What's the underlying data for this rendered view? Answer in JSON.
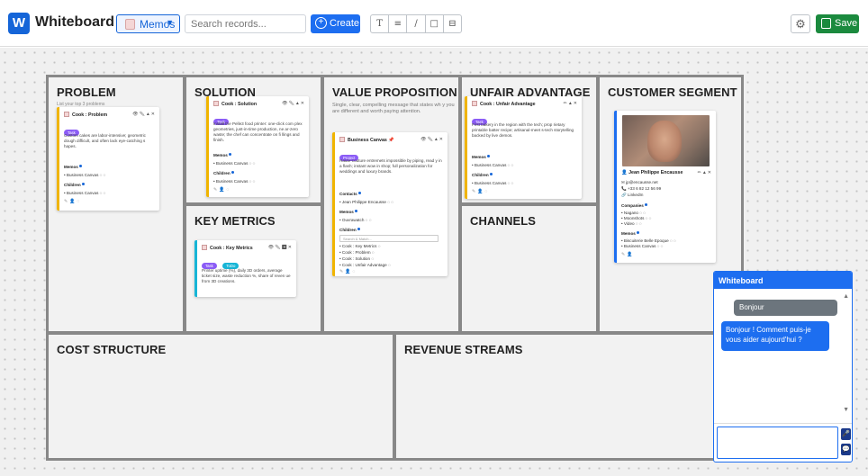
{
  "header": {
    "logo_letter": "W",
    "app_title": "Whiteboard",
    "memos_label": "Memos",
    "search_placeholder": "Search records...",
    "create_label": "Create",
    "tools": [
      "T",
      "≡",
      "/",
      "□",
      "⊟"
    ],
    "settings_icon": "gear-icon",
    "save_label": "Save"
  },
  "board": {
    "problem": {
      "title": "PROBLEM",
      "sub": "List your top 3 problems",
      "card": {
        "title": "Cook : Problem",
        "tags": [
          "Task"
        ],
        "desc": "Custom cakes are labor-intensive; geometric dough difficult, and often lack eye-catching s hapes.",
        "memos_label": "Memos",
        "memos": [
          "Business Canvas"
        ],
        "children_label": "Children",
        "children": [
          "Business Canvas"
        ]
      }
    },
    "solution": {
      "title": "SOLUTION",
      "card": {
        "title": "Cook : Solution",
        "tags": [
          "Task"
        ],
        "desc": "Install the Pelle3 food printer: one-click com plex geometries, just-in-time production, ne ar-zero waste; the chef can concentrate on fi llings and finish.",
        "memos_label": "Memos",
        "memos": [
          "Business Canvas"
        ],
        "children_label": "Children",
        "children": [
          "Business Canvas"
        ]
      }
    },
    "value": {
      "title": "VALUE PROPOSITION",
      "sub": "Single, clear, compelling message that states wh y you are different and worth paying attention.",
      "card": {
        "title": "Business Canvas",
        "tags": [
          "Project"
        ],
        "desc": "Haute-couture entremets impossible by piping, read y in a flash; instant wow in shop; full personalization for weddings and luxury brands.",
        "contacts_label": "Contacts",
        "contacts": [
          "Jean Philippe Encausse"
        ],
        "memos_label": "Memos",
        "memos": [
          "Ouvrawatch"
        ],
        "children_label": "Children",
        "children_search": "Search & Match...",
        "children": [
          "Cook : Key Metrics",
          "Cook : Problem",
          "Cook : Solution",
          "Cook : Unfair Advantage"
        ]
      }
    },
    "unfair": {
      "title": "UNFAIR ADVANTAGE",
      "card": {
        "title": "Cook : Unfair Advantage",
        "tags": [
          "Task"
        ],
        "desc": "First bakery in the region with the tech; prop rietary printable batter recipe; artisanal-meet s-tech storytelling backed by live demos.",
        "memos_label": "Memos",
        "memos": [
          "Business Canvas"
        ],
        "children_label": "Children",
        "children": [
          "Business Canvas"
        ]
      }
    },
    "customer": {
      "title": "CUSTOMER SEGMENT",
      "card": {
        "name": "Jean Philippe Encausse",
        "email": "jp@encausse.net",
        "phone": "+33 6 82 12 56 99",
        "linkedin": "LinkedIn",
        "companies_label": "Companies",
        "companies": [
          "Nagano",
          "Moonshots",
          "Video"
        ],
        "memos_label": "Memos",
        "memos": [
          "Biscuiterie Belle Epoque",
          "Business Canvas"
        ]
      }
    },
    "key_metrics": {
      "title": "KEY METRICS",
      "card": {
        "title": "Cook : Key Metrics",
        "tags": [
          "Task",
          "ToDo"
        ],
        "desc": "Printer uptime (%), daily 3D orders, average ticket size, waste reduction %, share of reven ue from 3D creations."
      }
    },
    "channels": {
      "title": "CHANNELS"
    },
    "cost": {
      "title": "COST STRUCTURE"
    },
    "revenue": {
      "title": "REVENUE STREAMS"
    }
  },
  "chat": {
    "title": "Whiteboard",
    "user_msg": "Bonjour",
    "bot_msg": "Bonjour ! Comment puis-je vous aider aujourd'hui ?",
    "input_value": ""
  },
  "colors": {
    "accent": "#1d6ef0",
    "save": "#1b8a3e",
    "card_bar_yellow": "#f0b400",
    "card_bar_blue": "#1d6ef0",
    "tag_task": "#8b5cf6",
    "tag_todo": "#17b5d6"
  }
}
